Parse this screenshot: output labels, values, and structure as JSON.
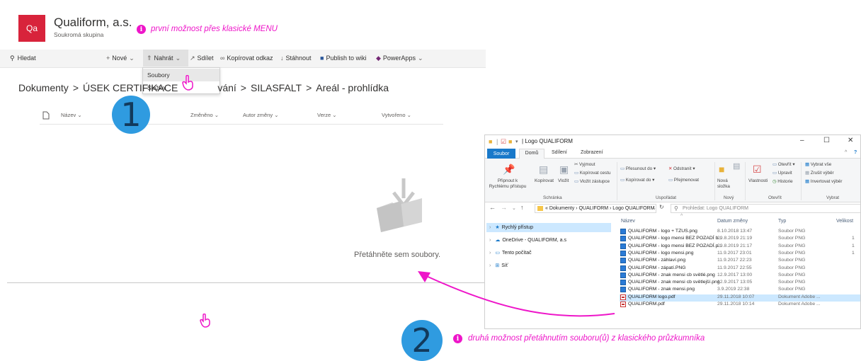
{
  "sharepoint": {
    "logo_text": "Qa",
    "site_title": "Qualiform, a.s.",
    "site_subtitle": "Soukromá skupina",
    "search_label": "Hledat",
    "commands": [
      {
        "label": "Nové",
        "icon": "plus-icon"
      },
      {
        "label": "Nahrát",
        "icon": "upload-arrow-icon"
      },
      {
        "label": "Sdílet",
        "icon": "share-icon"
      },
      {
        "label": "Kopírovat odkaz",
        "icon": "link-icon"
      },
      {
        "label": "Stáhnout",
        "icon": "download-icon"
      },
      {
        "label": "Publish to wiki",
        "icon": "word-icon"
      },
      {
        "label": "PowerApps",
        "icon": "powerapps-icon"
      }
    ],
    "upload_menu": [
      "Soubory",
      "Složka"
    ],
    "breadcrumb": [
      "Dokumenty",
      "ÚSEK CERTIFIKACE",
      "vání",
      "SILASFALT",
      "Areál - prohlídka"
    ],
    "breadcrumb_sep": ">",
    "columns": [
      "Název",
      "Změněno",
      "Autor změny",
      "Verze",
      "Vytvořeno"
    ],
    "drop_hint": "Přetáhněte sem soubory."
  },
  "explorer": {
    "title": "Logo QUALIFORM",
    "tabs": [
      "Soubor",
      "Domů",
      "Sdílení",
      "Zobrazení"
    ],
    "ribbon": {
      "pin": "Připnout k Rychlému přístupu",
      "copy": "Kopírovat",
      "paste": "Vložit",
      "cut": "Vyjmout",
      "copy_path": "Kopírovat cestu",
      "paste_shortcut": "Vložit zástupce",
      "move_to": "Přesunout do",
      "copy_to": "Kopírovat do",
      "delete": "Odstranit",
      "rename": "Přejmenovat",
      "new_folder": "Nová složka",
      "properties": "Vlastnosti",
      "open": "Otevřít",
      "edit": "Upravit",
      "history": "Historie",
      "select_all": "Vybrat vše",
      "select_none": "Zrušit výběr",
      "invert": "Invertovat výběr",
      "groups": [
        "Schránka",
        "Uspořádat",
        "Nový",
        "Otevřít",
        "Vybrat"
      ]
    },
    "address_path": "« Dokumenty  ›  QUALIFORM  ›  Logo QUALIFORM",
    "search_placeholder": "Prohledat: Logo QUALIFORM",
    "nav_pane": [
      "Rychlý přístup",
      "OneDrive - QUALIFORM, a.s",
      "Tento počítač",
      "Síť"
    ],
    "file_columns": [
      "Název",
      "Datum změny",
      "Typ",
      "Velikost"
    ],
    "files": [
      {
        "name": "QUALIFORM - logo + TZUS.png",
        "date": "8.10.2018 13:47",
        "type": "Soubor PNG",
        "kind": "png"
      },
      {
        "name": "QUALIFORM - logo mensi BEZ POZADÍ b...",
        "date": "29.8.2019 21:19",
        "type": "Soubor PNG",
        "kind": "png"
      },
      {
        "name": "QUALIFORM - logo mensi BEZ POZADÍ.p...",
        "date": "29.8.2019 21:17",
        "type": "Soubor PNG",
        "kind": "png"
      },
      {
        "name": "QUALIFORM - logo mensi.png",
        "date": "11.9.2017 23:01",
        "type": "Soubor PNG",
        "kind": "png"
      },
      {
        "name": "QUALIFORM - záhlaví.png",
        "date": "11.9.2017 22:23",
        "type": "Soubor PNG",
        "kind": "png"
      },
      {
        "name": "QUALIFORM - zápatí.PNG",
        "date": "11.9.2017 22:55",
        "type": "Soubor PNG",
        "kind": "png"
      },
      {
        "name": "QUALIFORM - znak mensi cb světlé.png",
        "date": "12.9.2017 13:00",
        "type": "Soubor PNG",
        "kind": "png"
      },
      {
        "name": "QUALIFORM - znak mensi cb světlejší.png",
        "date": "12.9.2017 13:05",
        "type": "Soubor PNG",
        "kind": "png"
      },
      {
        "name": "QUALIFORM - znak mensi.png",
        "date": "3.9.2019 22:38",
        "type": "Soubor PNG",
        "kind": "png"
      },
      {
        "name": "QUALIFORM logo.pdf",
        "date": "29.11.2018 10:07",
        "type": "Dokument Adobe ...",
        "kind": "pdf"
      },
      {
        "name": "QUALIFORM.pdf",
        "date": "29.11.2018 10:14",
        "type": "Dokument Adobe ...",
        "kind": "pdf"
      }
    ],
    "size_digits": [
      "1",
      "1",
      "1"
    ]
  },
  "annotations": {
    "note_1": "první možnost přes klasické MENU",
    "note_2": "druhá možnost přetáhnutím souboru(ů) z klasického průzkumníka",
    "step_1": "1",
    "step_2": "2",
    "info_glyph": "i",
    "accent_color": "#ee16c9",
    "step_color": "#2f9be0"
  }
}
